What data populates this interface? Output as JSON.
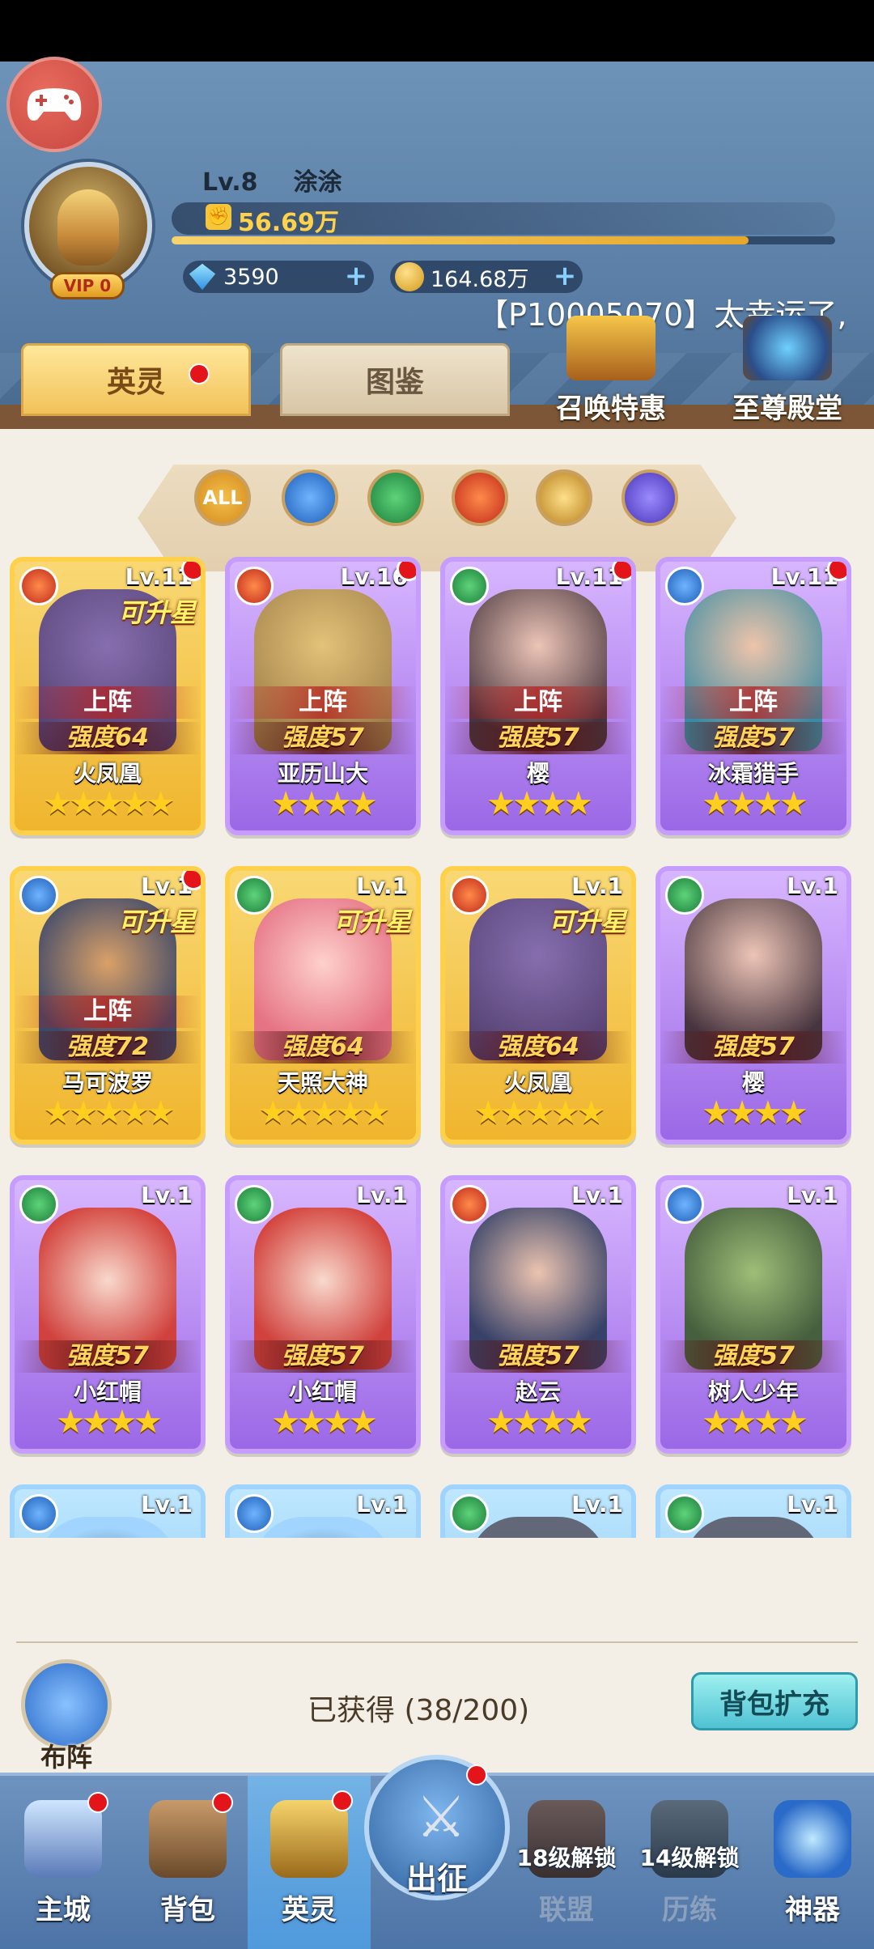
{
  "player": {
    "level": "Lv.8",
    "name": "涂涂",
    "vip": "VIP 0",
    "power": "56.69万",
    "diamonds": "3590",
    "gold": "164.68万"
  },
  "marquee": "【P10005070】太幸运了,",
  "tabs": {
    "heroes": "英灵",
    "guide": "图鉴",
    "summon": "召唤特惠",
    "hall": "至尊殿堂"
  },
  "filters": [
    "ALL"
  ],
  "heroes": [
    {
      "name": "火凤凰",
      "level": "Lv.11",
      "power": "强度64",
      "stars": "★★★★★",
      "deployed": "上阵",
      "upgrade": "可升星"
    },
    {
      "name": "亚历山大",
      "level": "Lv.16",
      "power": "强度57",
      "stars": "★★★★",
      "deployed": "上阵",
      "upgrade": ""
    },
    {
      "name": "樱",
      "level": "Lv.11",
      "power": "强度57",
      "stars": "★★★★",
      "deployed": "上阵",
      "upgrade": ""
    },
    {
      "name": "冰霜猎手",
      "level": "Lv.11",
      "power": "强度57",
      "stars": "★★★★",
      "deployed": "上阵",
      "upgrade": ""
    },
    {
      "name": "马可波罗",
      "level": "Lv.1",
      "power": "强度72",
      "stars": "★★★★★",
      "deployed": "上阵",
      "upgrade": "可升星"
    },
    {
      "name": "天照大神",
      "level": "Lv.1",
      "power": "强度64",
      "stars": "★★★★★",
      "deployed": "",
      "upgrade": "可升星"
    },
    {
      "name": "火凤凰",
      "level": "Lv.1",
      "power": "强度64",
      "stars": "★★★★★",
      "deployed": "",
      "upgrade": "可升星"
    },
    {
      "name": "樱",
      "level": "Lv.1",
      "power": "强度57",
      "stars": "★★★★",
      "deployed": "",
      "upgrade": ""
    },
    {
      "name": "小红帽",
      "level": "Lv.1",
      "power": "强度57",
      "stars": "★★★★",
      "deployed": "",
      "upgrade": ""
    },
    {
      "name": "小红帽",
      "level": "Lv.1",
      "power": "强度57",
      "stars": "★★★★",
      "deployed": "",
      "upgrade": ""
    },
    {
      "name": "赵云",
      "level": "Lv.1",
      "power": "强度57",
      "stars": "★★★★",
      "deployed": "",
      "upgrade": ""
    },
    {
      "name": "树人少年",
      "level": "Lv.1",
      "power": "强度57",
      "stars": "★★★★",
      "deployed": "",
      "upgrade": ""
    },
    {
      "name": "",
      "level": "Lv.1",
      "power": "",
      "stars": "",
      "deployed": "",
      "upgrade": ""
    },
    {
      "name": "",
      "level": "Lv.1",
      "power": "",
      "stars": "",
      "deployed": "",
      "upgrade": ""
    },
    {
      "name": "",
      "level": "Lv.1",
      "power": "",
      "stars": "",
      "deployed": "",
      "upgrade": ""
    },
    {
      "name": "",
      "level": "Lv.1",
      "power": "",
      "stars": "",
      "deployed": "",
      "upgrade": ""
    }
  ],
  "footer": {
    "formation": "布阵",
    "owned": "已获得 (38/200)",
    "expand": "背包扩充"
  },
  "nav": {
    "city": "主城",
    "bag": "背包",
    "heroes": "英灵",
    "battle": "出征",
    "alliance": "联盟",
    "alliance_lock": "18级解锁",
    "training": "历练",
    "training_lock": "14级解锁",
    "artifact": "神器"
  }
}
